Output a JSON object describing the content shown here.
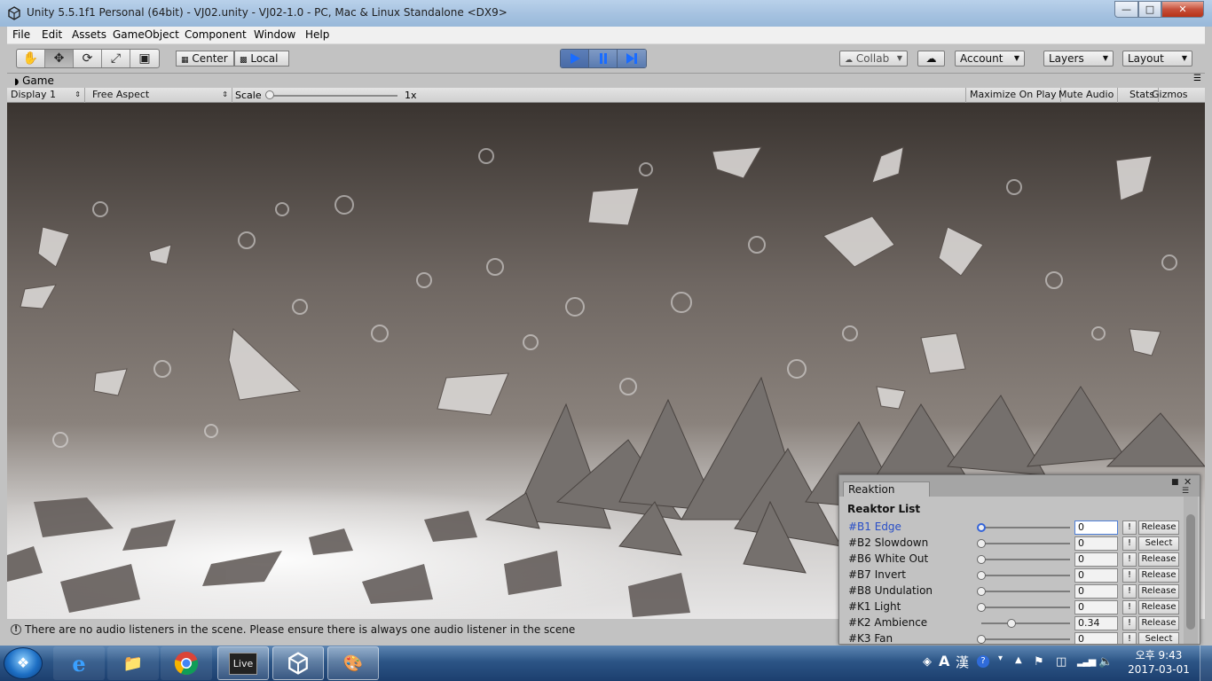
{
  "window": {
    "title": "Unity 5.5.1f1 Personal (64bit) - VJ02.unity - VJ02-1.0 - PC, Mac & Linux Standalone <DX9>"
  },
  "menu": [
    "File",
    "Edit",
    "Assets",
    "GameObject",
    "Component",
    "Window",
    "Help"
  ],
  "toolbar": {
    "tools": [
      "hand-tool",
      "move-tool",
      "rotate-tool",
      "scale-tool",
      "rect-tool"
    ],
    "pivot_label": "Center",
    "space_label": "Local",
    "collab_label": "Collab",
    "account_label": "Account",
    "layers_label": "Layers",
    "layout_label": "Layout"
  },
  "game_tab": {
    "label": "Game"
  },
  "game_toolbar": {
    "display": "Display 1",
    "aspect": "Free Aspect",
    "scale_label": "Scale",
    "scale_value": "1x",
    "maximize": "Maximize On Play",
    "mute": "Mute Audio",
    "stats": "Stats",
    "gizmos": "Gizmos"
  },
  "status": {
    "message": "There are no audio listeners in the scene. Please ensure there is always one audio listener in the scene"
  },
  "reaktion": {
    "tab_label": "Reaktion",
    "list_title": "Reaktor List",
    "rows": [
      {
        "name": "#B1 Edge",
        "value": "0",
        "slider": 0.0,
        "button": "Release",
        "selected": true
      },
      {
        "name": "#B2 Slowdown",
        "value": "0",
        "slider": 0.0,
        "button": "Select",
        "selected": false
      },
      {
        "name": "#B6 White Out",
        "value": "0",
        "slider": 0.0,
        "button": "Release",
        "selected": false
      },
      {
        "name": "#B7 Invert",
        "value": "0",
        "slider": 0.0,
        "button": "Release",
        "selected": false
      },
      {
        "name": "#B8 Undulation",
        "value": "0",
        "slider": 0.0,
        "button": "Release",
        "selected": false
      },
      {
        "name": "#K1 Light",
        "value": "0",
        "slider": 0.0,
        "button": "Release",
        "selected": false
      },
      {
        "name": "#K2 Ambience",
        "value": "0.34",
        "slider": 0.34,
        "button": "Release",
        "selected": false
      },
      {
        "name": "#K3 Fan",
        "value": "0",
        "slider": 0.0,
        "button": "Select",
        "selected": false
      }
    ],
    "excl_label": "!"
  },
  "taskbar": {
    "apps": [
      "internet-explorer",
      "file-explorer",
      "chrome",
      "ableton-live",
      "unity",
      "paint"
    ],
    "live_label": "Live",
    "ime": "A",
    "hanja": "漢",
    "time": "오후 9:43",
    "date": "2017-03-01"
  }
}
